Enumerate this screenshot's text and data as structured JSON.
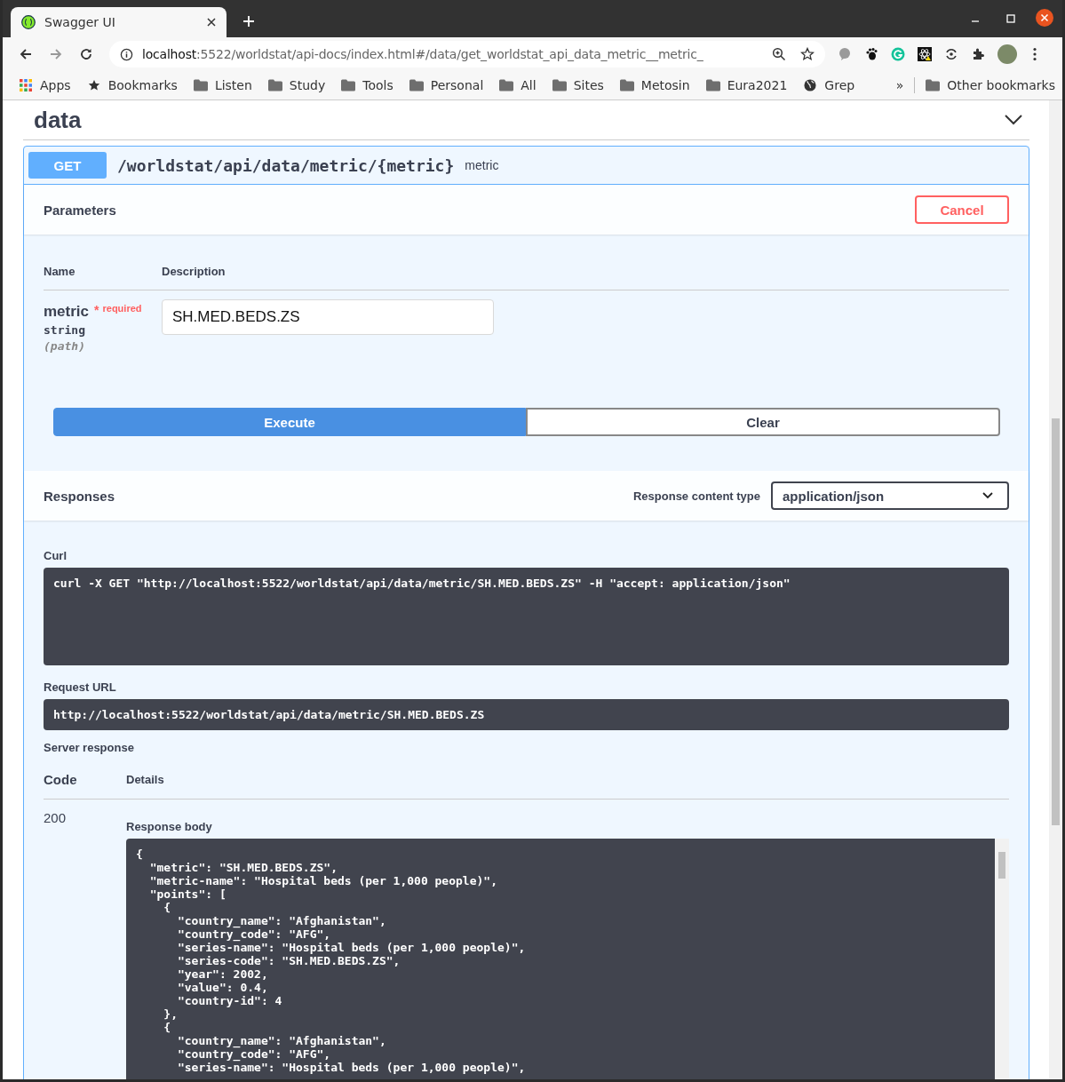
{
  "browser": {
    "tab": {
      "title": "Swagger UI",
      "selected": true
    },
    "url": {
      "host": "localhost",
      "path": ":5522/worldstat/api-docs/index.html#/data/get_worldstat_api_data_metric__metric_"
    },
    "bookmarks": [
      {
        "kind": "apps",
        "label": "Apps"
      },
      {
        "kind": "star",
        "label": "Bookmarks"
      },
      {
        "kind": "folder",
        "label": "Listen"
      },
      {
        "kind": "folder",
        "label": "Study"
      },
      {
        "kind": "folder",
        "label": "Tools"
      },
      {
        "kind": "folder",
        "label": "Personal"
      },
      {
        "kind": "folder",
        "label": "All"
      },
      {
        "kind": "folder",
        "label": "Sites"
      },
      {
        "kind": "folder",
        "label": "Metosin"
      },
      {
        "kind": "folder",
        "label": "Eura2021"
      },
      {
        "kind": "globe",
        "label": "Grep"
      }
    ],
    "overflow": "»",
    "other_bookmarks": "Other bookmarks"
  },
  "section": {
    "title": "data",
    "expanded": true
  },
  "operation": {
    "method": "GET",
    "path": "/worldstat/api/data/metric/{metric}",
    "summary": "metric",
    "parameters": {
      "title": "Parameters",
      "cancel": "Cancel",
      "columns": [
        "Name",
        "Description"
      ],
      "items": [
        {
          "name": "metric",
          "required_mark": "*",
          "required": "required",
          "type": "string",
          "in": "(path)",
          "value": "SH.MED.BEDS.ZS"
        }
      ]
    },
    "execute": "Execute",
    "clear": "Clear",
    "responses": {
      "title": "Responses",
      "content_type_label": "Response content type",
      "content_type": "application/json",
      "curl_label": "Curl",
      "curl": "curl -X GET \"http://localhost:5522/worldstat/api/data/metric/SH.MED.BEDS.ZS\" -H \"accept: application/json\"",
      "request_url_label": "Request URL",
      "request_url": "http://localhost:5522/worldstat/api/data/metric/SH.MED.BEDS.ZS",
      "server_response_label": "Server response",
      "columns": [
        "Code",
        "Details"
      ],
      "code": "200",
      "body_label": "Response body",
      "body_lines": [
        "{",
        "  \"metric\": \"SH.MED.BEDS.ZS\",",
        "  \"metric-name\": \"Hospital beds (per 1,000 people)\",",
        "  \"points\": [",
        "    {",
        "      \"country_name\": \"Afghanistan\",",
        "      \"country_code\": \"AFG\",",
        "      \"series-name\": \"Hospital beds (per 1,000 people)\",",
        "      \"series-code\": \"SH.MED.BEDS.ZS\",",
        "      \"year\": 2002,",
        "      \"value\": 0.4,",
        "      \"country-id\": 4",
        "    },",
        "    {",
        "      \"country_name\": \"Afghanistan\",",
        "      \"country_code\": \"AFG\",",
        "      \"series-name\": \"Hospital beds (per 1,000 people)\","
      ]
    }
  }
}
